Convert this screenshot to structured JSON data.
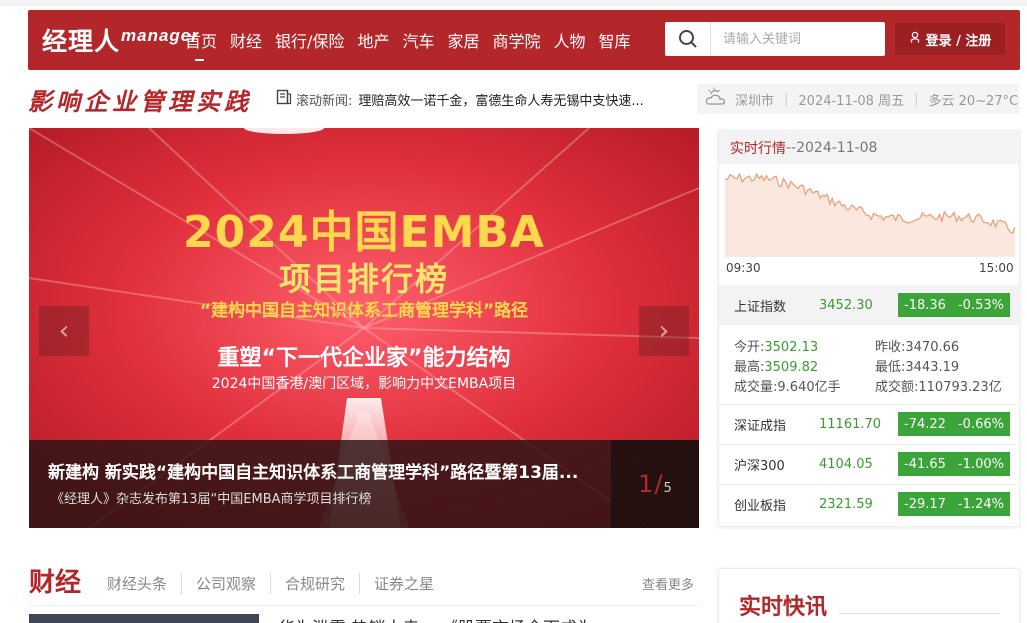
{
  "header": {
    "logo_main": "经理人",
    "logo_sup": "manager",
    "nav": [
      "首页",
      "财经",
      "银行/保险",
      "地产",
      "汽车",
      "家居",
      "商学院",
      "人物",
      "智库"
    ],
    "search_placeholder": "请输入关键词",
    "login_label": "登录 / 注册"
  },
  "slogan": "影响企业管理实践",
  "ticker": {
    "label": "滚动新闻:",
    "text": "理赔高效一诺千金，富德生命人寿无锡中支快速..."
  },
  "weather": {
    "city": "深圳市",
    "date": "2024-11-08 周五",
    "condition": "多云 20~27°C"
  },
  "banner": {
    "line1": "2024中国EMBA",
    "line2": "项目排行榜",
    "line3": "“建构中国自主知识体系工商管理学科”路径",
    "line4": "重塑“下一代企业家”能力结构",
    "line5": "2024中国香港/澳门区域，影响力中文EMBA项目",
    "caption_title": "新建构 新实践“建构中国自主知识体系工商管理学科”路径暨第13届...",
    "caption_sub": "《经理人》杂志发布第13届“中国EMBA商学项目排行榜",
    "pager_current": "1",
    "pager_total": "5"
  },
  "market": {
    "title_red": "实时行情",
    "title_date": "--2024-11-08",
    "axis_start": "09:30",
    "axis_end": "15:00",
    "main_index": {
      "name": "上证指数",
      "value": "3452.30",
      "change": "-18.36",
      "pct": "-0.53%"
    },
    "details": {
      "open_label": "今开:",
      "open": "3502.13",
      "prev_label": "昨收:",
      "prev": "3470.66",
      "high_label": "最高:",
      "high": "3509.82",
      "low_label": "最低:",
      "low": "3443.19",
      "vol_label": "成交量:",
      "vol": "9.640亿手",
      "amt_label": "成交额:",
      "amt": "110793.23亿"
    },
    "indices": [
      {
        "name": "深证成指",
        "value": "11161.70",
        "change": "-74.22",
        "pct": "-0.66%"
      },
      {
        "name": "沪深300",
        "value": "4104.05",
        "change": "-41.65",
        "pct": "-1.00%"
      },
      {
        "name": "创业板指",
        "value": "2321.59",
        "change": "-29.17",
        "pct": "-1.24%"
      }
    ],
    "chart_color": "#e8a27e"
  },
  "section": {
    "title": "财经",
    "tabs": [
      "财经头条",
      "公司观察",
      "合规研究",
      "证券之星"
    ],
    "more": "查看更多",
    "headline_snippet": "华为泄露 热销大卖... 《股票市场全面成为"
  },
  "kuaixun": "实时快讯",
  "colors": {
    "brand": "#b3262a",
    "up_down_green": "#3ba53a"
  }
}
